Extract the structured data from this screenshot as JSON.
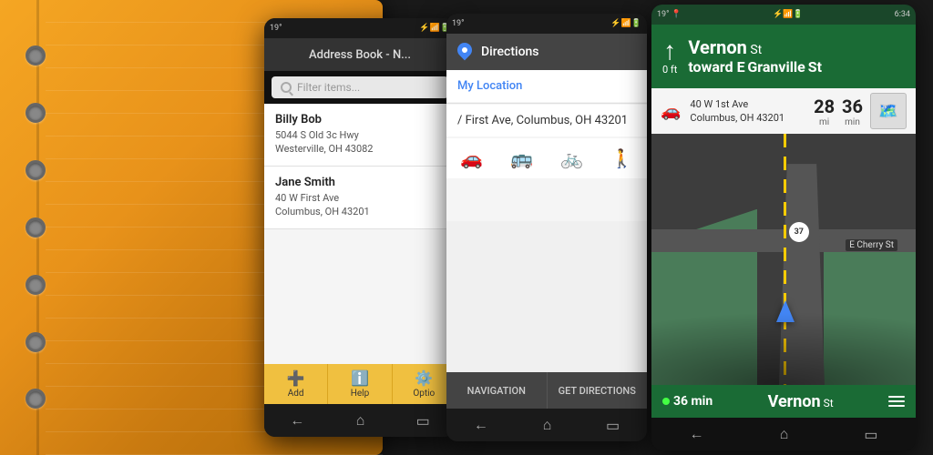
{
  "notebook": {
    "rings_count": 7
  },
  "phone1": {
    "status_bar": {
      "left": "19°",
      "icons": "🔋📶",
      "time": ""
    },
    "title": "Address Book - N...",
    "search_placeholder": "Filter items...",
    "contacts": [
      {
        "name": "Billy Bob",
        "address_line1": "5044 S Old 3c Hwy",
        "address_line2": "Westerville, OH 43082"
      },
      {
        "name": "Jane Smith",
        "address_line1": "40 W First Ave",
        "address_line2": "Columbus, OH 43201"
      }
    ],
    "bottom_buttons": [
      {
        "icon": "➕",
        "label": "Add"
      },
      {
        "icon": "ℹ️",
        "label": "Help"
      },
      {
        "icon": "⚙️",
        "label": "Optio"
      }
    ],
    "nav_icons": [
      "←",
      "⌂",
      "▭"
    ]
  },
  "phone2": {
    "status_bar": {
      "left": "19°",
      "icons": "📶🔋",
      "time": ""
    },
    "title": "Directions",
    "map_icon": "📍",
    "from_label": "My Location",
    "to_label": "/ First Ave, Columbus, OH 43201",
    "transport_modes": [
      "🚗",
      "🚌",
      "🚲",
      "🚶"
    ],
    "bottom_buttons": [
      {
        "label": "NAVIGATION"
      },
      {
        "label": "GET DIRECTIONS"
      }
    ],
    "nav_icons": [
      "←",
      "⌂",
      "▭"
    ]
  },
  "phone3": {
    "status_bar": {
      "left": "19° 📍",
      "right": "6:34"
    },
    "nav_direction": "↑",
    "nav_distance": "0 ft",
    "street_name": "Vernon",
    "street_suffix": "St",
    "toward_label": "toward E",
    "toward_street": "Granville",
    "toward_suffix": "St",
    "driving_mode": "🚗 Driving",
    "distance": "28 mi",
    "duration": "36 min",
    "destination_addr1": "40 W 1st Ave",
    "destination_addr2": "Columbus, OH 43201",
    "map_street_label": "E Cherry St",
    "route_number": "37",
    "eta_time": "36 min",
    "bottom_street": "Vernon",
    "bottom_street_suffix": "St",
    "nav_icons": [
      "←",
      "⌂",
      "▭"
    ]
  }
}
